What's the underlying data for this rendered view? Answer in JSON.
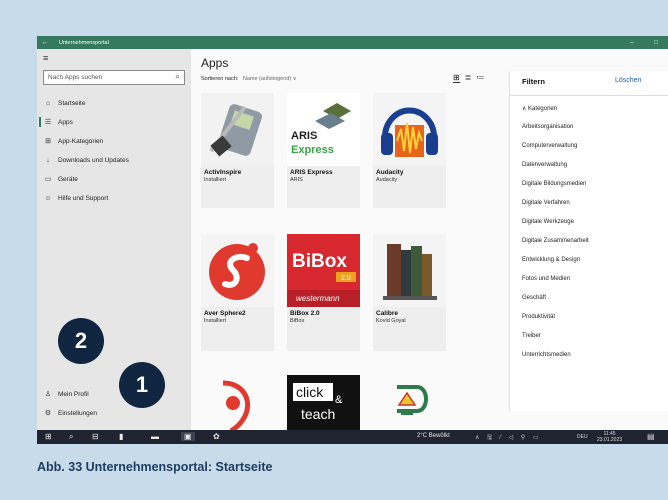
{
  "window": {
    "title": "Unternehmensportal",
    "back_glyph": "←",
    "min_glyph": "–",
    "max_glyph": "□"
  },
  "sidebar": {
    "menu_glyph": "≡",
    "search_placeholder": "Nach Apps suchen",
    "items": [
      {
        "label": "Startseite",
        "icon": "home-icon",
        "glyph": "⌂"
      },
      {
        "label": "Apps",
        "icon": "apps-list-icon",
        "glyph": "☰"
      },
      {
        "label": "App-Kategorien",
        "icon": "categories-icon",
        "glyph": "⊞"
      },
      {
        "label": "Downloads und Updates",
        "icon": "download-icon",
        "glyph": "↓"
      },
      {
        "label": "Geräte",
        "icon": "device-icon",
        "glyph": "▭"
      },
      {
        "label": "Hilfe und Support",
        "icon": "help-icon",
        "glyph": "☺"
      }
    ],
    "bottom": [
      {
        "label": "Mein Profil",
        "icon": "person-icon",
        "glyph": "♙"
      },
      {
        "label": "Einstellungen",
        "icon": "settings-icon",
        "glyph": "⚙"
      }
    ]
  },
  "badges": [
    "2",
    "1"
  ],
  "main": {
    "heading": "Apps",
    "sort_label": "Sortieren nach:",
    "sort_value": "Name (aufsteigend) ∨",
    "view_icons": [
      "⊞",
      "≣",
      "≔"
    ],
    "apps": [
      {
        "name": "ActivInspire",
        "sub": "Installiert",
        "brand": "#7a8a99"
      },
      {
        "name": "ARIS Express",
        "sub": "ARIS",
        "brand": "#3aa34a",
        "logo_line1": "ARIS",
        "logo_line2": "Express"
      },
      {
        "name": "Audacity",
        "sub": "Audacity",
        "brand": "#e8641b"
      },
      {
        "name": "Aver Sphere2",
        "sub": "Installiert",
        "brand": "#e03a2f"
      },
      {
        "name": "BiBox 2.0",
        "sub": "BiBox",
        "brand": "#d7282f",
        "logo_line1": "BiBox",
        "logo_line2": "2.0",
        "logo_line3": "westermann"
      },
      {
        "name": "Calibre",
        "sub": "Kovid Goyal",
        "brand": "#6b3b2a"
      },
      {
        "name": "",
        "sub": "",
        "brand": "#e03a2f"
      },
      {
        "name": "",
        "sub": "",
        "brand": "#111111",
        "logo_line1": "click",
        "logo_line2": "&",
        "logo_line3": "teach"
      },
      {
        "name": "",
        "sub": "",
        "brand": "#f2c230"
      }
    ]
  },
  "filter": {
    "title": "Filtern",
    "clear": "Löschen",
    "group": "∧  Kategorien",
    "categories": [
      "Arbeitsorganisation",
      "Computerverwaltung",
      "Datenverwaltung",
      "Digitale Bildungsmedien",
      "Digitale Verfahren",
      "Digitale Werkzeuge",
      "Digitale Zusammenarbeit",
      "Entwicklung & Design",
      "Fotos und Medien",
      "Geschäft",
      "Produktivität",
      "Treiber",
      "Unterrichtsmedien"
    ]
  },
  "taskbar": {
    "weather": "2°C Bewölkt",
    "tray": "∧ 🖫 ⁄ ◁ ⚲ ▭",
    "lang": "DEU",
    "time": "11:45",
    "date": "23.01.2023",
    "start_glyph": "⊞",
    "search_glyph": "⌕",
    "taskview_glyph": "⊟",
    "app_glyphs": [
      "▮",
      "▬",
      "▣",
      "✿"
    ],
    "notif_glyph": "▤"
  },
  "caption": "Abb. 33  Unternehmensportal: Startseite"
}
